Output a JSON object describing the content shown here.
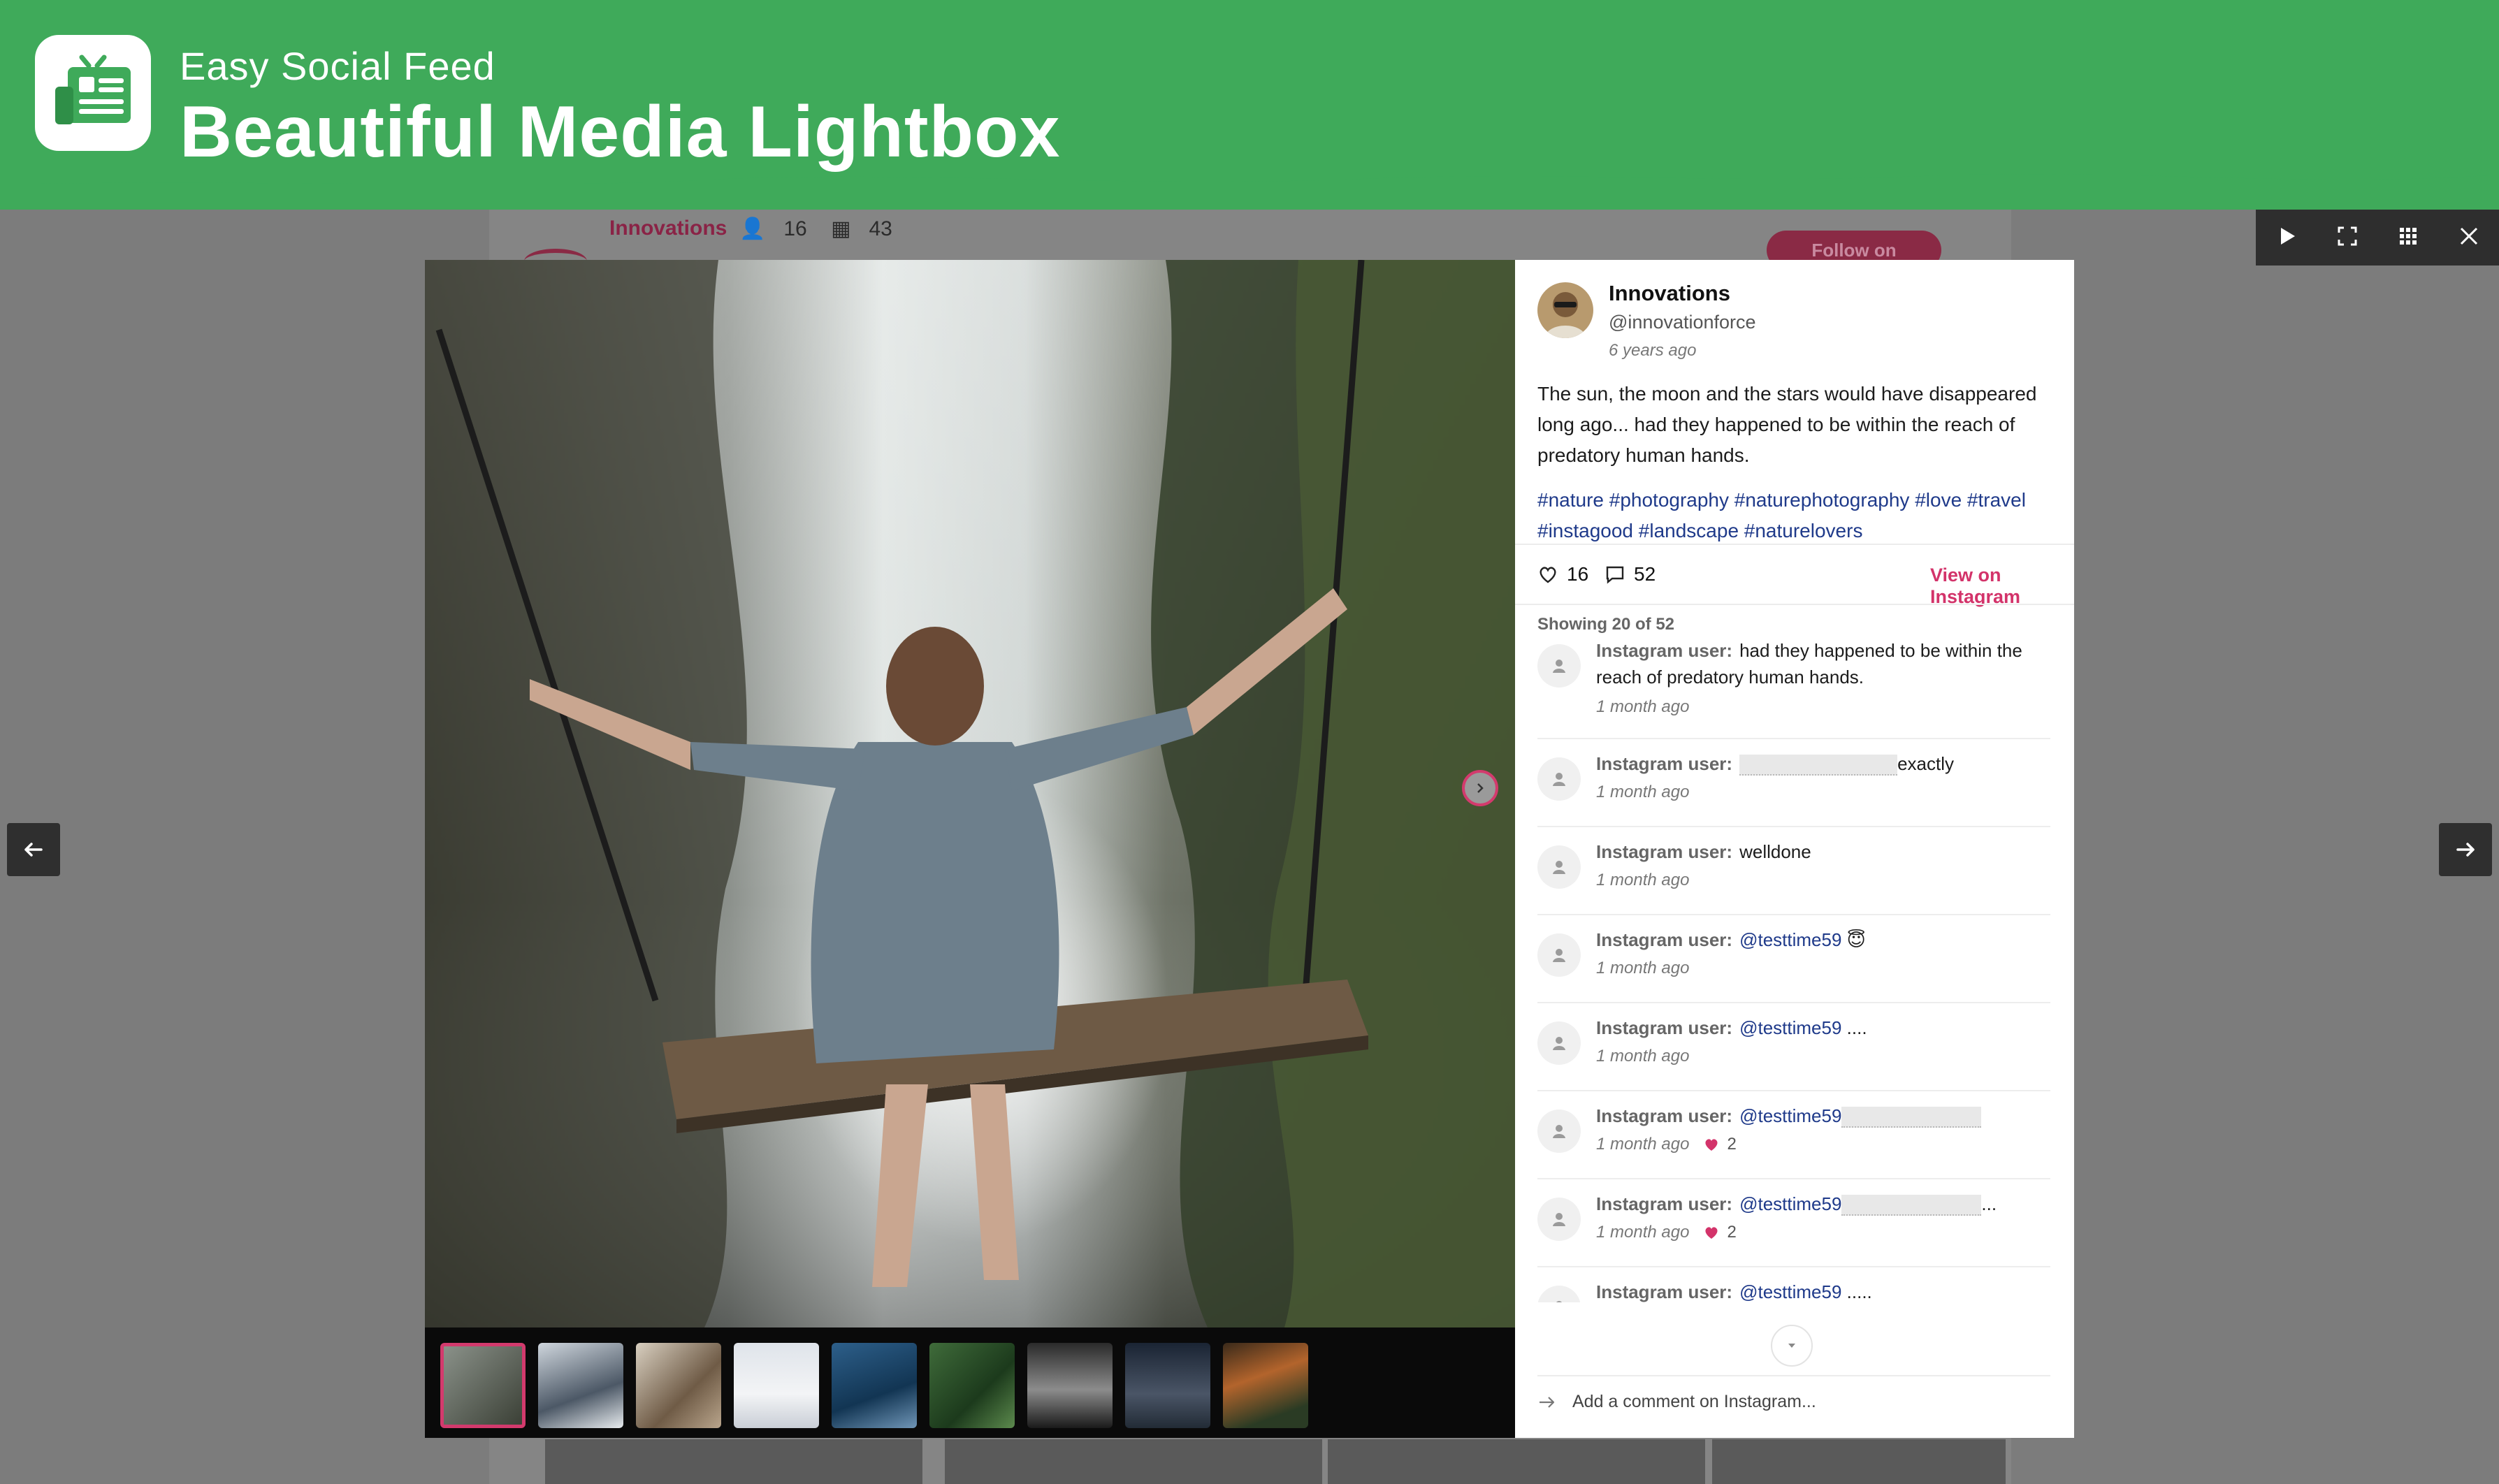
{
  "header": {
    "subtitle": "Easy Social Feed",
    "title": "Beautiful Media Lightbox"
  },
  "background_feed": {
    "name": "Innovations",
    "followers": "16",
    "posts": "43",
    "follow_label": "Follow on Instagram"
  },
  "toolbar": {
    "icons": [
      "play-icon",
      "fullscreen-icon",
      "grid-icon",
      "close-icon"
    ]
  },
  "post": {
    "author_name": "Innovations",
    "author_handle": "@innovationforce",
    "time": "6 years ago",
    "caption": "The sun, the moon and the stars would have disappeared long ago... had they happened to be within the reach of predatory human hands.",
    "hashtags": "#nature #photography #naturephotography #love #travel #instagood #landscape #naturelovers",
    "likes": "16",
    "comments_count": "52",
    "view_label": "View on Instagram"
  },
  "comments_panel": {
    "showing": "Showing 20 of 52",
    "add_placeholder": "Add a comment on Instagram...",
    "items": [
      {
        "user": "Instagram user:",
        "text": "had they happened to be within the reach of predatory human hands.",
        "time": "1 month ago",
        "likes": ""
      },
      {
        "user": "Instagram user:",
        "text": "exactly",
        "time": "1 month ago",
        "likes": ""
      },
      {
        "user": "Instagram user:",
        "text": "welldone",
        "time": "1 month ago",
        "likes": ""
      },
      {
        "user": "Instagram user:",
        "mention": "@testtime59",
        "text": "😇",
        "time": "1 month ago",
        "likes": ""
      },
      {
        "user": "Instagram user:",
        "mention": "@testtime59",
        "text": "....",
        "time": "1 month ago",
        "likes": ""
      },
      {
        "user": "Instagram user:",
        "mention": "@testtime59",
        "text": "",
        "time": "1 month ago",
        "likes": "2"
      },
      {
        "user": "Instagram user:",
        "mention": "@testtime59",
        "text": "...",
        "time": "1 month ago",
        "likes": "2"
      },
      {
        "user": "Instagram user:",
        "mention": "@testtime59",
        "text": ".....",
        "time": "",
        "likes": ""
      }
    ]
  },
  "colors": {
    "brand_green": "#3faa5a",
    "accent_pink": "#d3336a",
    "hashtag_blue": "#1f3a8a"
  }
}
